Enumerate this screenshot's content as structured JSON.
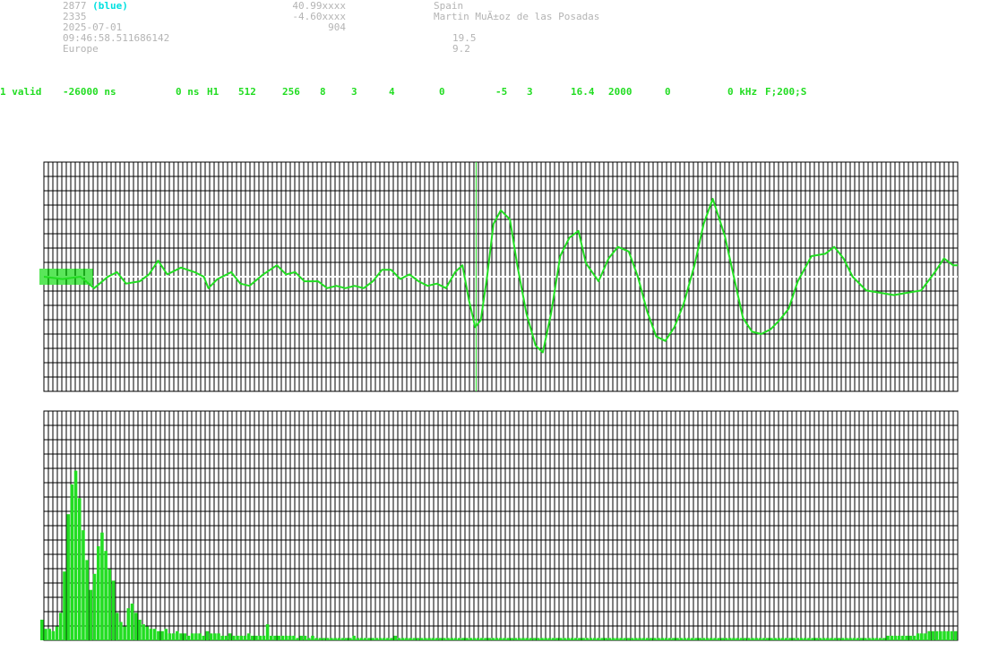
{
  "header": {
    "station_id": "2877",
    "station_tag": "(blue)",
    "number": "2335",
    "date": "2025-07-01",
    "time": "09:46:58.511686142",
    "region": "Europe",
    "latitude": "40.99xxxx",
    "longitude": "-4.60xxxx",
    "altitude": "904",
    "country": "Spain",
    "operator": "Martin MuÃ±oz de las Posadas",
    "value1": "19.5",
    "value2": "9.2"
  },
  "status_line": [
    "1 valid",
    "-26000 ns",
    "0 ns",
    "H1",
    "512",
    "256",
    "8",
    "3",
    "4",
    "0",
    "-5",
    "3",
    "16.4",
    "2000",
    "0",
    "0 kHz",
    "F;200;S"
  ],
  "colors": {
    "trace": "#22dd22",
    "grid": "#000000",
    "header_text": "#b4b4b4",
    "accent": "#00e0e0"
  },
  "waveform": {
    "marker_position": 0.473,
    "trace": [
      [
        0.0,
        0.5
      ],
      [
        0.02,
        0.49
      ],
      [
        0.04,
        0.5
      ],
      [
        0.055,
        0.45
      ],
      [
        0.07,
        0.5
      ],
      [
        0.08,
        0.52
      ],
      [
        0.09,
        0.47
      ],
      [
        0.105,
        0.48
      ],
      [
        0.115,
        0.51
      ],
      [
        0.125,
        0.57
      ],
      [
        0.135,
        0.51
      ],
      [
        0.15,
        0.54
      ],
      [
        0.165,
        0.52
      ],
      [
        0.175,
        0.5
      ],
      [
        0.18,
        0.45
      ],
      [
        0.19,
        0.49
      ],
      [
        0.205,
        0.52
      ],
      [
        0.215,
        0.47
      ],
      [
        0.225,
        0.46
      ],
      [
        0.24,
        0.51
      ],
      [
        0.255,
        0.55
      ],
      [
        0.265,
        0.51
      ],
      [
        0.275,
        0.52
      ],
      [
        0.285,
        0.48
      ],
      [
        0.3,
        0.48
      ],
      [
        0.31,
        0.45
      ],
      [
        0.32,
        0.46
      ],
      [
        0.33,
        0.45
      ],
      [
        0.34,
        0.46
      ],
      [
        0.35,
        0.45
      ],
      [
        0.36,
        0.48
      ],
      [
        0.37,
        0.53
      ],
      [
        0.38,
        0.53
      ],
      [
        0.39,
        0.49
      ],
      [
        0.4,
        0.51
      ],
      [
        0.41,
        0.48
      ],
      [
        0.42,
        0.46
      ],
      [
        0.43,
        0.47
      ],
      [
        0.44,
        0.45
      ],
      [
        0.45,
        0.52
      ],
      [
        0.458,
        0.55
      ],
      [
        0.465,
        0.4
      ],
      [
        0.472,
        0.28
      ],
      [
        0.478,
        0.31
      ],
      [
        0.485,
        0.5
      ],
      [
        0.492,
        0.73
      ],
      [
        0.5,
        0.79
      ],
      [
        0.51,
        0.75
      ],
      [
        0.518,
        0.55
      ],
      [
        0.528,
        0.34
      ],
      [
        0.538,
        0.2
      ],
      [
        0.546,
        0.17
      ],
      [
        0.555,
        0.34
      ],
      [
        0.565,
        0.59
      ],
      [
        0.575,
        0.67
      ],
      [
        0.585,
        0.7
      ],
      [
        0.593,
        0.56
      ],
      [
        0.6,
        0.52
      ],
      [
        0.607,
        0.48
      ],
      [
        0.618,
        0.58
      ],
      [
        0.628,
        0.63
      ],
      [
        0.64,
        0.61
      ],
      [
        0.65,
        0.5
      ],
      [
        0.66,
        0.35
      ],
      [
        0.67,
        0.24
      ],
      [
        0.68,
        0.22
      ],
      [
        0.69,
        0.28
      ],
      [
        0.7,
        0.38
      ],
      [
        0.712,
        0.55
      ],
      [
        0.722,
        0.73
      ],
      [
        0.732,
        0.84
      ],
      [
        0.745,
        0.68
      ],
      [
        0.755,
        0.5
      ],
      [
        0.765,
        0.32
      ],
      [
        0.775,
        0.26
      ],
      [
        0.785,
        0.25
      ],
      [
        0.795,
        0.27
      ],
      [
        0.805,
        0.31
      ],
      [
        0.815,
        0.36
      ],
      [
        0.825,
        0.48
      ],
      [
        0.84,
        0.59
      ],
      [
        0.855,
        0.6
      ],
      [
        0.865,
        0.63
      ],
      [
        0.875,
        0.58
      ],
      [
        0.885,
        0.5
      ],
      [
        0.9,
        0.44
      ],
      [
        0.915,
        0.43
      ],
      [
        0.93,
        0.42
      ],
      [
        0.945,
        0.43
      ],
      [
        0.96,
        0.44
      ],
      [
        0.975,
        0.52
      ],
      [
        0.985,
        0.58
      ],
      [
        0.995,
        0.55
      ],
      [
        1.0,
        0.55
      ]
    ]
  },
  "spectrum": {
    "bars": [
      0.09,
      0.05,
      0.05,
      0.04,
      0.06,
      0.12,
      0.3,
      0.55,
      0.68,
      0.74,
      0.62,
      0.48,
      0.35,
      0.22,
      0.29,
      0.41,
      0.47,
      0.39,
      0.31,
      0.26,
      0.12,
      0.08,
      0.06,
      0.14,
      0.16,
      0.12,
      0.09,
      0.07,
      0.06,
      0.05,
      0.05,
      0.04,
      0.04,
      0.05,
      0.03,
      0.03,
      0.04,
      0.03,
      0.03,
      0.02,
      0.03,
      0.03,
      0.03,
      0.02,
      0.04,
      0.03,
      0.03,
      0.03,
      0.02,
      0.02,
      0.03,
      0.02,
      0.02,
      0.02,
      0.02,
      0.03,
      0.02,
      0.02,
      0.02,
      0.02,
      0.07,
      0.02,
      0.02,
      0.02,
      0.02,
      0.02,
      0.02,
      0.02,
      0.01,
      0.02,
      0.02,
      0.01,
      0.02,
      0.01,
      0.01,
      0.01,
      0.01,
      0.01,
      0.01,
      0.01,
      0.01,
      0.01,
      0.01,
      0.02,
      0.01,
      0.01,
      0.01,
      0.01,
      0.01,
      0.01,
      0.01,
      0.01,
      0.01,
      0.01,
      0.02,
      0.01,
      0.01,
      0.01,
      0.01,
      0.01,
      0.01,
      0.01,
      0.01,
      0.01,
      0.01,
      0.01,
      0.01,
      0.01,
      0.01,
      0.01,
      0.01,
      0.01,
      0.01,
      0.01,
      0.01,
      0.01,
      0.01,
      0.01,
      0.01,
      0.01,
      0.01,
      0.01,
      0.01,
      0.01,
      0.01,
      0.01,
      0.01,
      0.01,
      0.01,
      0.01,
      0.01,
      0.01,
      0.01,
      0.01,
      0.01,
      0.01,
      0.01,
      0.01,
      0.01,
      0.01,
      0.01,
      0.01,
      0.01,
      0.01,
      0.01,
      0.01,
      0.01,
      0.01,
      0.01,
      0.01,
      0.01,
      0.01,
      0.01,
      0.01,
      0.01,
      0.01,
      0.01,
      0.01,
      0.01,
      0.01,
      0.01,
      0.01,
      0.01,
      0.01,
      0.01,
      0.01,
      0.01,
      0.01,
      0.01,
      0.01,
      0.01,
      0.01,
      0.01,
      0.01,
      0.01,
      0.01,
      0.01,
      0.01,
      0.01,
      0.01,
      0.01,
      0.01,
      0.01,
      0.01,
      0.01,
      0.01,
      0.01,
      0.01,
      0.01,
      0.01,
      0.01,
      0.01,
      0.01,
      0.01,
      0.01,
      0.01,
      0.01,
      0.01,
      0.01,
      0.01,
      0.01,
      0.01,
      0.01,
      0.01,
      0.01,
      0.01,
      0.01,
      0.01,
      0.01,
      0.01,
      0.01,
      0.01,
      0.01,
      0.01,
      0.01,
      0.01,
      0.01,
      0.01,
      0.01,
      0.01,
      0.01,
      0.01,
      0.01,
      0.01,
      0.01,
      0.02,
      0.02,
      0.02,
      0.02,
      0.02,
      0.02,
      0.02,
      0.02,
      0.03,
      0.03,
      0.03,
      0.04,
      0.04,
      0.04,
      0.04,
      0.04,
      0.04,
      0.04,
      0.04
    ]
  }
}
